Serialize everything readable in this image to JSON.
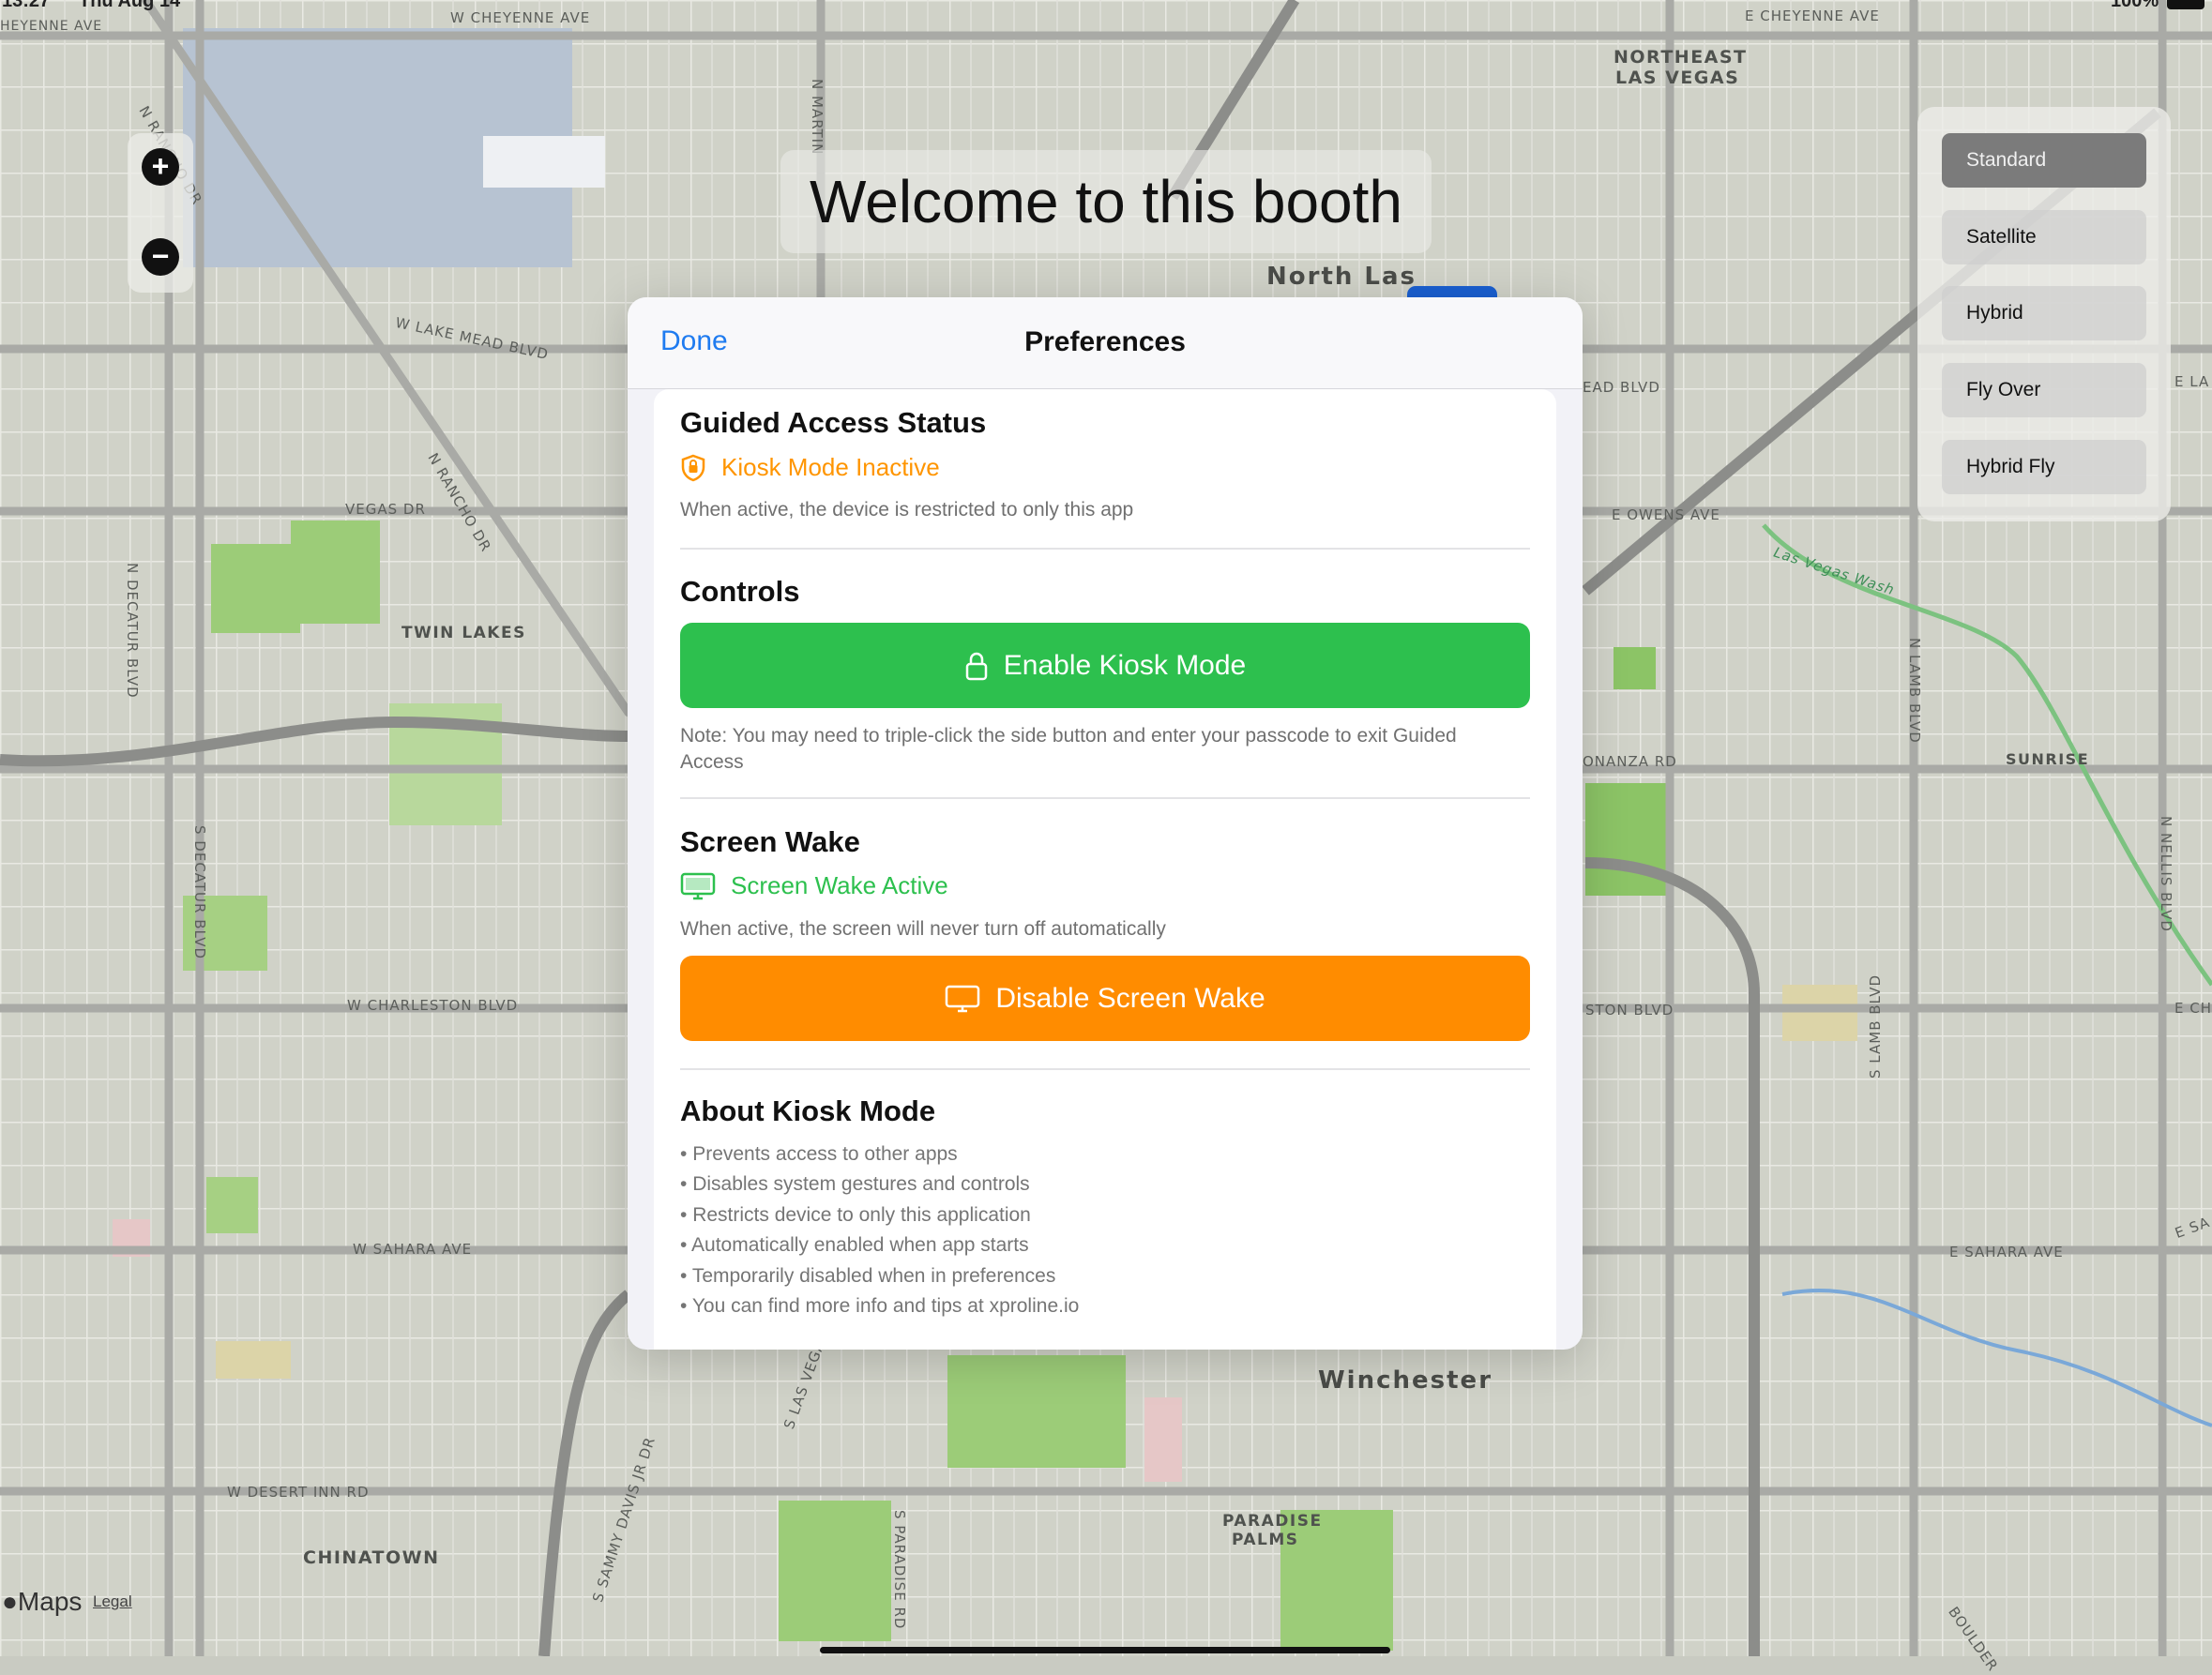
{
  "status_bar": {
    "time": "13:27",
    "date": "Thu Aug 14",
    "battery": "100%"
  },
  "map": {
    "labels": [
      "W CHEYENNE AVE",
      "E CHEYENNE AVE",
      "NORTHEAST",
      "LAS VEGAS",
      "W LAKE MEAD BLVD",
      "VEGAS DR",
      "TWIN LAKES",
      "N DECATUR BLVD",
      "N RANCHO DR",
      "S DECATUR BLVD",
      "W CHARLESTON BLVD",
      "W SAHARA AVE",
      "E SAHARA AVE",
      "W DESERT INN RD",
      "CHINATOWN",
      "Winchester",
      "PARADISE",
      "PALMS",
      "SUNRISE",
      "E OWENS AVE",
      "N LAMB BLVD",
      "S LAMB BLVD",
      "N NELLIS BLVD",
      "S PARADISE RD",
      "S LAS VEGAS",
      "Las Vegas Wash",
      "N MARTIN",
      "North Las",
      "HEYENNE AVE",
      "EAD BLVD",
      "ONANZA RD",
      "STON BLVD",
      "E CH",
      "E LA",
      "E SA",
      "BOULDER",
      "S SAMMY DAVIS JR DR",
      "N RANCHO DR"
    ],
    "attribution": "Maps",
    "legal": "Legal"
  },
  "zoom": {
    "in_label": "+",
    "out_label": "−"
  },
  "welcome_banner": "Welcome to this booth",
  "map_types": {
    "items": [
      "Standard",
      "Satellite",
      "Hybrid",
      "Fly Over",
      "Hybrid Fly"
    ],
    "selected": "Standard"
  },
  "preferences": {
    "title": "Preferences",
    "done_label": "Done",
    "guided_access": {
      "title": "Guided Access Status",
      "status": "Kiosk Mode Inactive",
      "status_color": "#ff9500",
      "caption": "When active, the device is restricted to only this app"
    },
    "controls": {
      "title": "Controls",
      "button_label": "Enable Kiosk Mode",
      "button_color": "#2dc04e",
      "note": "Note: You may need to triple-click the side button and enter your passcode to exit Guided Access"
    },
    "screen_wake": {
      "title": "Screen Wake",
      "status": "Screen Wake Active",
      "status_color": "#2dc04e",
      "caption": "When active, the screen will never turn off automatically",
      "button_label": "Disable Screen Wake",
      "button_color": "#ff8c00"
    },
    "about": {
      "title": "About Kiosk Mode",
      "items": [
        "Prevents access to other apps",
        "Disables system gestures and controls",
        "Restricts device to only this application",
        "Automatically enabled when app starts",
        "Temporarily disabled when in preferences",
        "You can find more info and tips at xproline.io"
      ]
    }
  }
}
